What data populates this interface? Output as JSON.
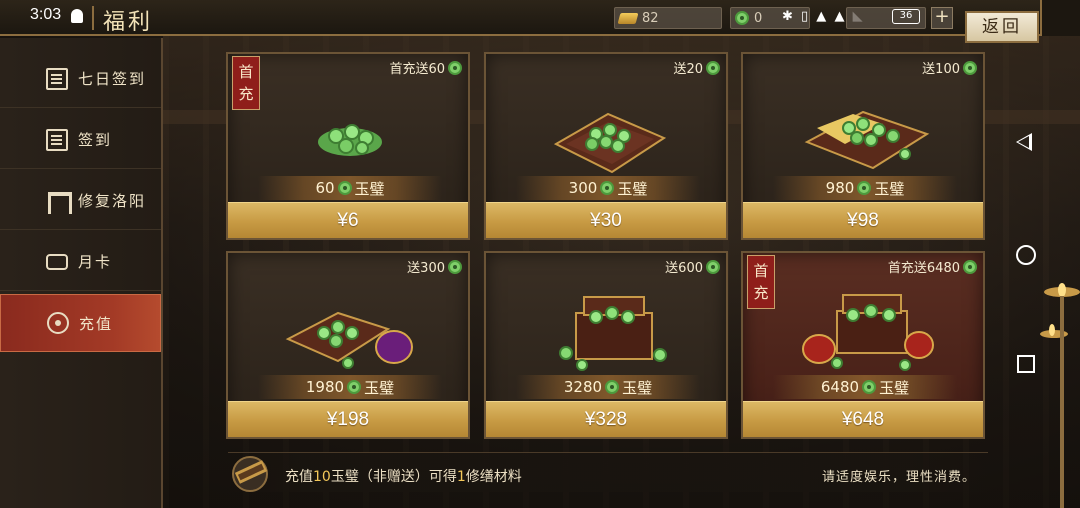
{
  "status_bar": {
    "time": "3:03",
    "battery": "36"
  },
  "header": {
    "title": "福利",
    "back_label": "返回"
  },
  "currency": {
    "gold": "82",
    "jade": "0",
    "plus": "+"
  },
  "sidebar": {
    "items": [
      {
        "label": "七日签到",
        "icon": "calendar-icon"
      },
      {
        "label": "签到",
        "icon": "calendar-icon"
      },
      {
        "label": "修复洛阳",
        "icon": "gate-icon"
      },
      {
        "label": "月卡",
        "icon": "tv-icon"
      },
      {
        "label": "充值",
        "icon": "coin-icon",
        "active": true
      }
    ]
  },
  "packages": [
    {
      "bonus": "首充送60",
      "first_tag": "首充",
      "amount": "60",
      "unit": "玉璧",
      "price": "¥6"
    },
    {
      "bonus": "送20",
      "first_tag": "",
      "amount": "300",
      "unit": "玉璧",
      "price": "¥30"
    },
    {
      "bonus": "送100",
      "first_tag": "",
      "amount": "980",
      "unit": "玉璧",
      "price": "¥98"
    },
    {
      "bonus": "送300",
      "first_tag": "",
      "amount": "1980",
      "unit": "玉璧",
      "price": "¥198"
    },
    {
      "bonus": "送600",
      "first_tag": "",
      "amount": "3280",
      "unit": "玉璧",
      "price": "¥328"
    },
    {
      "bonus": "首充送6480",
      "first_tag": "首充",
      "amount": "6480",
      "unit": "玉璧",
      "price": "¥648"
    }
  ],
  "info": {
    "prefix": "充值",
    "count": "10",
    "middle": "玉璧（非赠送）可得",
    "count2": "1",
    "suffix": "修缮材料",
    "right_note": "请适度娱乐，理性消费。"
  },
  "colors": {
    "accent_gold": "#c79a43",
    "active_red": "#a33a26",
    "jade_green": "#7fcf6a"
  }
}
